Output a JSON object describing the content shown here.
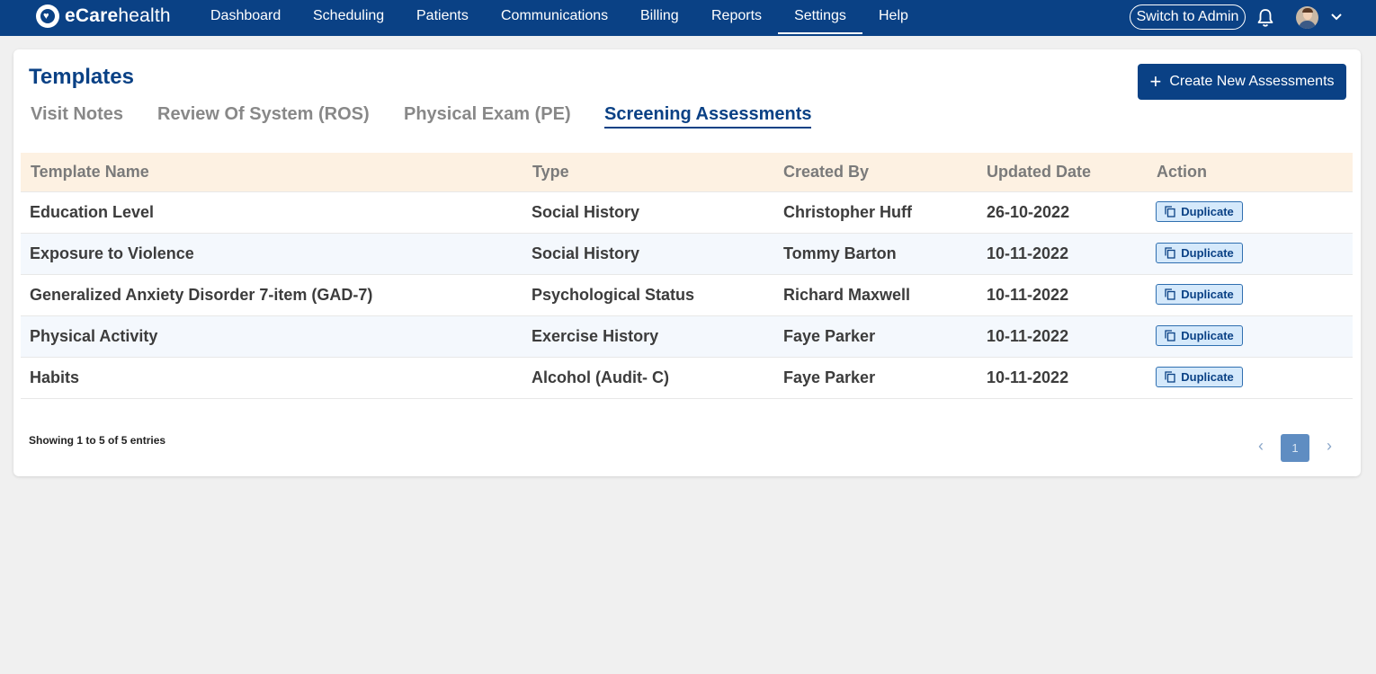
{
  "brand": {
    "name_bold": "eCare",
    "name_rest": "health",
    "colors": {
      "primary": "#0a4185",
      "header_row": "#fdf1e2",
      "alt_row": "#f4f8fd"
    }
  },
  "nav": {
    "items": [
      {
        "label": "Dashboard"
      },
      {
        "label": "Scheduling"
      },
      {
        "label": "Patients"
      },
      {
        "label": "Communications"
      },
      {
        "label": "Billing"
      },
      {
        "label": "Reports"
      },
      {
        "label": "Settings",
        "active": true
      },
      {
        "label": "Help"
      }
    ],
    "switch_admin": "Switch to Admin",
    "icons": [
      "bell-icon",
      "avatar",
      "chevron-down-icon"
    ]
  },
  "page": {
    "title": "Templates",
    "create_button": "Create New Assessments",
    "tabs": [
      {
        "label": "Visit Notes"
      },
      {
        "label": "Review Of System (ROS)"
      },
      {
        "label": "Physical Exam (PE)"
      },
      {
        "label": "Screening Assessments",
        "active": true
      }
    ]
  },
  "table": {
    "columns": [
      "Template Name",
      "Type",
      "Created By",
      "Updated Date",
      "Action"
    ],
    "rows": [
      {
        "name": "Education Level",
        "type": "Social History",
        "created_by": "Christopher Huff",
        "updated": "26-10-2022",
        "action": "Duplicate"
      },
      {
        "name": "Exposure to Violence",
        "type": "Social History",
        "created_by": "Tommy Barton",
        "updated": "10-11-2022",
        "action": "Duplicate"
      },
      {
        "name": "Generalized Anxiety Disorder 7-item (GAD-7)",
        "type": "Psychological Status",
        "created_by": "Richard Maxwell",
        "updated": "10-11-2022",
        "action": "Duplicate"
      },
      {
        "name": "Physical Activity",
        "type": "Exercise History",
        "created_by": "Faye Parker",
        "updated": "10-11-2022",
        "action": "Duplicate"
      },
      {
        "name": "Habits",
        "type": "Alcohol (Audit- C)",
        "created_by": "Faye Parker",
        "updated": "10-11-2022",
        "action": "Duplicate"
      }
    ]
  },
  "footer": {
    "showing_prefix": "Showing ",
    "from": "1",
    "to_word": " to ",
    "to": "5",
    "of_word": " of ",
    "total": "5",
    "suffix": " entries",
    "current_page": "1",
    "prev_symbol": "‹",
    "next_symbol": "›"
  }
}
